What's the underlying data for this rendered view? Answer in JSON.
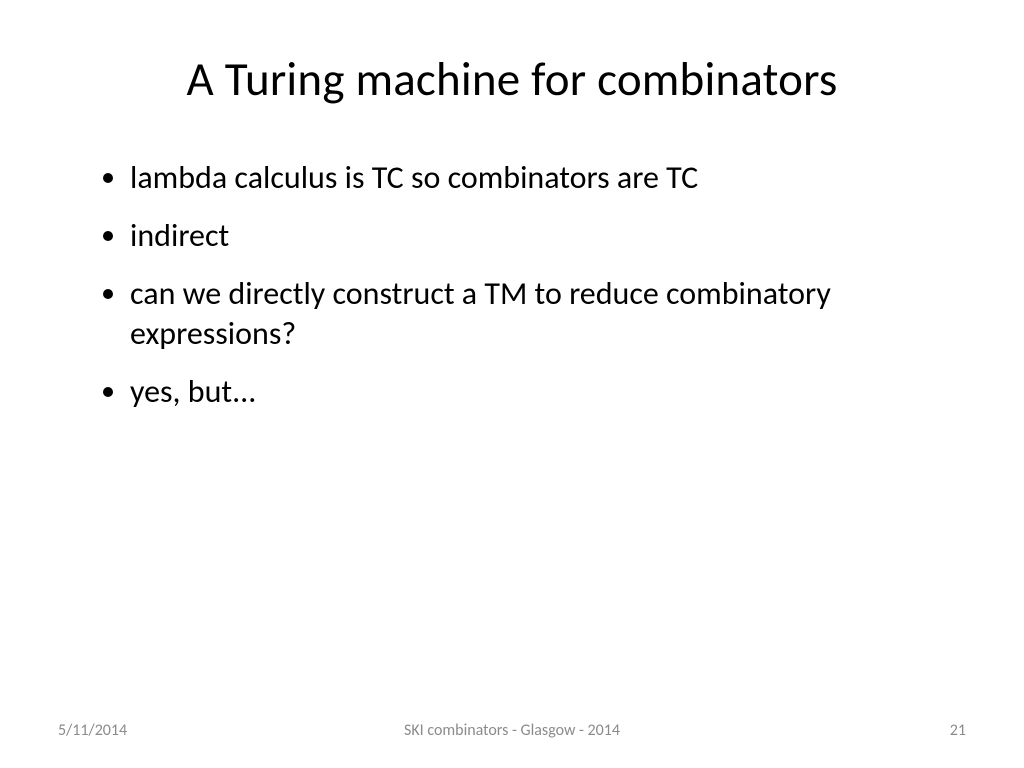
{
  "slide": {
    "title": "A Turing machine for combinators",
    "bullets": [
      "lambda calculus is TC so combinators are TC",
      "indirect",
      "can we directly construct a TM to reduce combinatory expressions?",
      "yes, but..."
    ],
    "footer": {
      "date": "5/11/2014",
      "center": "SKI combinators - Glasgow - 2014",
      "page": "21"
    }
  }
}
